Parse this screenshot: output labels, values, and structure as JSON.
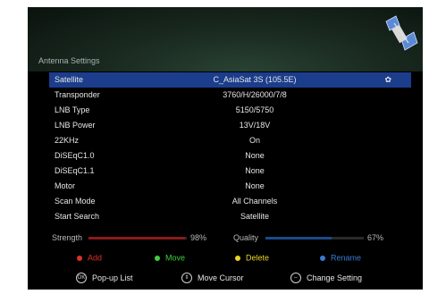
{
  "title": "Antenna Settings",
  "rows": [
    {
      "label": "Satellite",
      "value": "C_AsiaSat 3S (105.5E)"
    },
    {
      "label": "Transponder",
      "value": "3760/H/26000/7/8"
    },
    {
      "label": "LNB Type",
      "value": "5150/5750"
    },
    {
      "label": "LNB Power",
      "value": "13V/18V"
    },
    {
      "label": "22KHz",
      "value": "On"
    },
    {
      "label": "DiSEqC1.0",
      "value": "None"
    },
    {
      "label": "DiSEqC1.1",
      "value": "None"
    },
    {
      "label": "Motor",
      "value": "None"
    },
    {
      "label": "Scan Mode",
      "value": "All Channels"
    },
    {
      "label": "Start Search",
      "value": "Satellite"
    }
  ],
  "selected_row": 0,
  "signal": {
    "strength_label": "Strength",
    "strength_pct": "98%",
    "strength_value": 0.98,
    "quality_label": "Quality",
    "quality_pct": "67%",
    "quality_value": 0.67
  },
  "color_keys": [
    {
      "label": "Add",
      "color": "#e0302a"
    },
    {
      "label": "Move",
      "color": "#3fcf3f"
    },
    {
      "label": "Delete",
      "color": "#e8d42a"
    },
    {
      "label": "Rename",
      "color": "#3a7bd5"
    }
  ],
  "hints": [
    {
      "label": "Pop-up List",
      "icon": "ok-button-icon"
    },
    {
      "label": "Move Cursor",
      "icon": "arrows-button-icon"
    },
    {
      "label": "Change Setting",
      "icon": "left-right-button-icon"
    }
  ]
}
